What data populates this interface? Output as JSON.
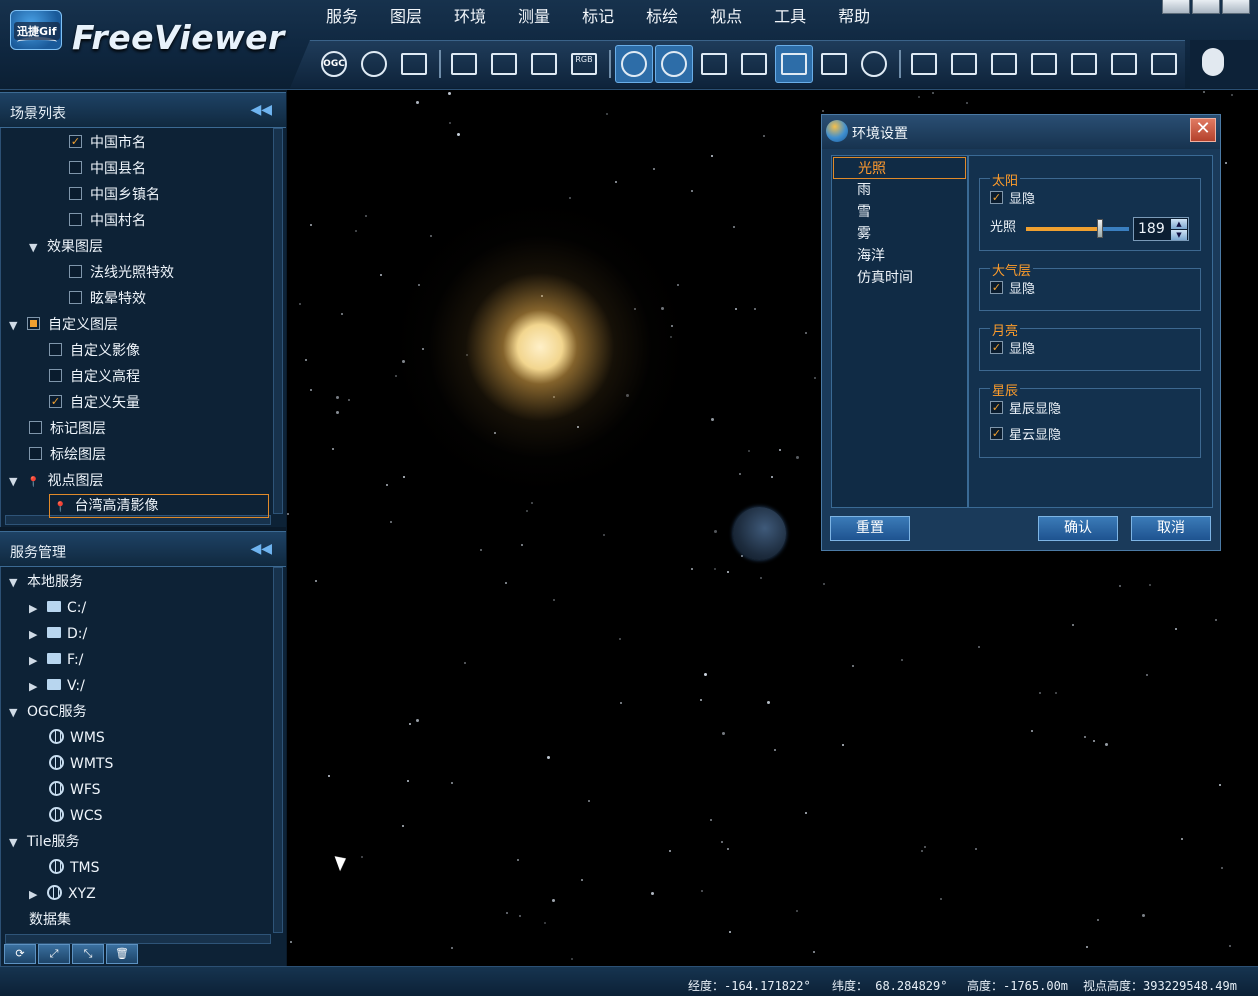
{
  "app": {
    "badge_text": "迅捷Gif",
    "name": "FreeViewer"
  },
  "menu": [
    "服务",
    "图层",
    "环境",
    "测量",
    "标记",
    "标绘",
    "视点",
    "工具",
    "帮助"
  ],
  "toolbar": {
    "icons": [
      "ogc-icon",
      "globe-icon",
      "layers-icon",
      "image-icon",
      "terrain-icon",
      "vector-icon",
      "rgb-icon",
      "sphere-icon",
      "sphere-dark-icon",
      "rain-icon",
      "snow-icon",
      "ocean-icon",
      "fog-icon",
      "gear-icon",
      "ruler-icon",
      "path-ruler-icon",
      "vertical-ruler-icon",
      "polygon-icon",
      "area-icon",
      "line-icon",
      "cone-icon"
    ],
    "ogc_label": "OGC",
    "rgb_label": "RGB"
  },
  "scene_panel": {
    "title": "场景列表",
    "items": [
      {
        "label": "中国市名",
        "checked": true,
        "indent": 3
      },
      {
        "label": "中国县名",
        "checked": false,
        "indent": 3
      },
      {
        "label": "中国乡镇名",
        "checked": false,
        "indent": 3
      },
      {
        "label": "中国村名",
        "checked": false,
        "indent": 3
      },
      {
        "label": "效果图层",
        "arrow": "▼",
        "indent": 1
      },
      {
        "label": "法线光照特效",
        "checked": false,
        "indent": 3
      },
      {
        "label": "眩晕特效",
        "checked": false,
        "indent": 3
      },
      {
        "label": "自定义图层",
        "arrow": "▼",
        "partial": true,
        "indent": 0
      },
      {
        "label": "自定义影像",
        "checked": false,
        "indent": 2
      },
      {
        "label": "自定义高程",
        "checked": false,
        "indent": 2
      },
      {
        "label": "自定义矢量",
        "checked": true,
        "indent": 2
      },
      {
        "label": "标记图层",
        "checked": false,
        "indent": 1
      },
      {
        "label": "标绘图层",
        "checked": false,
        "indent": 1
      },
      {
        "label": "视点图层",
        "arrow": "▼",
        "pin": true,
        "indent": 0
      },
      {
        "label": "台湾高清影像",
        "pin": true,
        "selected": true,
        "indent": 2
      }
    ]
  },
  "service_panel": {
    "title": "服务管理",
    "items": [
      {
        "label": "本地服务",
        "arrow": "▼",
        "indent": 0
      },
      {
        "label": "C:/",
        "arrow": "▶",
        "folder": true,
        "indent": 1
      },
      {
        "label": "D:/",
        "arrow": "▶",
        "folder": true,
        "indent": 1
      },
      {
        "label": "F:/",
        "arrow": "▶",
        "folder": true,
        "indent": 1
      },
      {
        "label": "V:/",
        "arrow": "▶",
        "folder": true,
        "indent": 1
      },
      {
        "label": "OGC服务",
        "arrow": "▼",
        "indent": 0
      },
      {
        "label": "WMS",
        "globe": true,
        "indent": 2
      },
      {
        "label": "WMTS",
        "globe": true,
        "indent": 2
      },
      {
        "label": "WFS",
        "globe": true,
        "indent": 2
      },
      {
        "label": "WCS",
        "globe": true,
        "indent": 2
      },
      {
        "label": "Tile服务",
        "arrow": "▼",
        "indent": 0
      },
      {
        "label": "TMS",
        "globe": true,
        "indent": 2
      },
      {
        "label": "XYZ",
        "arrow": "▶",
        "globe": true,
        "indent": 1
      },
      {
        "label": "数据集",
        "indent": 1
      }
    ],
    "tools": [
      "refresh-icon",
      "expand-icon",
      "collapse-icon",
      "delete-icon"
    ]
  },
  "dialog": {
    "title": "环境设置",
    "close": "✕",
    "tabs": [
      "光照",
      "雨",
      "雪",
      "雾",
      "海洋",
      "仿真时间"
    ],
    "selected_tab": 0,
    "sun": {
      "title": "太阳",
      "visible_label": "显隐",
      "light_label": "光照",
      "light_value": "189",
      "light_fraction": 0.72
    },
    "atmosphere": {
      "title": "大气层",
      "visible_label": "显隐"
    },
    "moon": {
      "title": "月亮",
      "visible_label": "显隐"
    },
    "stars": {
      "title": "星辰",
      "stars_label": "星辰显隐",
      "nebula_label": "星云显隐"
    },
    "reset": "重置",
    "ok": "确认",
    "cancel": "取消"
  },
  "status": {
    "lon": "经度：-164.171822°",
    "lat": "纬度： 68.284829°",
    "alt": "高度：-1765.00m",
    "view_alt": "视点高度：393229548.49m"
  }
}
